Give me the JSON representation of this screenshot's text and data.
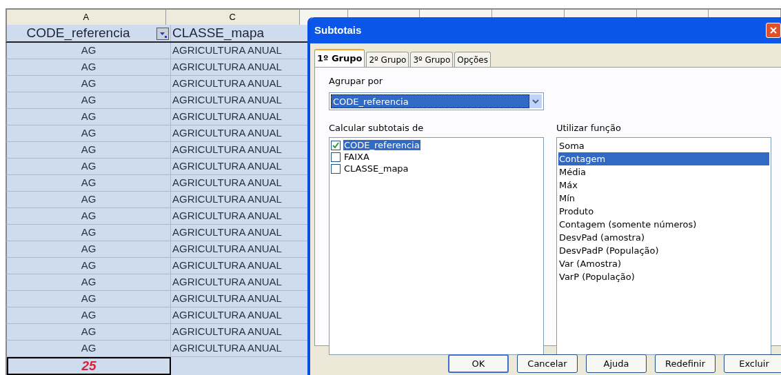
{
  "sheet": {
    "columns": [
      {
        "label": "A",
        "selected": true
      },
      {
        "label": "C",
        "selected": true
      }
    ],
    "header_row": {
      "col_a": "CODE_referencia",
      "col_c": "CLASSE_mapa",
      "filter": true
    },
    "rows": [
      [
        "AG",
        "AGRICULTURA ANUAL"
      ],
      [
        "AG",
        "AGRICULTURA ANUAL"
      ],
      [
        "AG",
        "AGRICULTURA ANUAL"
      ],
      [
        "AG",
        "AGRICULTURA ANUAL"
      ],
      [
        "AG",
        "AGRICULTURA ANUAL"
      ],
      [
        "AG",
        "AGRICULTURA ANUAL"
      ],
      [
        "AG",
        "AGRICULTURA ANUAL"
      ],
      [
        "AG",
        "AGRICULTURA ANUAL"
      ],
      [
        "AG",
        "AGRICULTURA ANUAL"
      ],
      [
        "AG",
        "AGRICULTURA ANUAL"
      ],
      [
        "AG",
        "AGRICULTURA ANUAL"
      ],
      [
        "AG",
        "AGRICULTURA ANUAL"
      ],
      [
        "AG",
        "AGRICULTURA ANUAL"
      ],
      [
        "AG",
        "AGRICULTURA ANUAL"
      ],
      [
        "AG",
        "AGRICULTURA ANUAL"
      ],
      [
        "AG",
        "AGRICULTURA ANUAL"
      ],
      [
        "AG",
        "AGRICULTURA ANUAL"
      ],
      [
        "AG",
        "AGRICULTURA ANUAL"
      ],
      [
        "AG",
        "AGRICULTURA ANUAL"
      ]
    ],
    "total": "25"
  },
  "dialog": {
    "title": "Subtotais",
    "tabs": [
      {
        "label": "1º Grupo",
        "selected": true
      },
      {
        "label": "2º Grupo",
        "selected": false
      },
      {
        "label": "3º Grupo",
        "selected": false
      },
      {
        "label": "Opções",
        "selected": false
      }
    ],
    "group_by": {
      "label": "Agrupar por",
      "value": "CODE_referencia"
    },
    "fields": {
      "label": "Calcular subtotais de",
      "items": [
        {
          "label": "CODE_referencia",
          "checked": true,
          "selected": true
        },
        {
          "label": "FAIXA",
          "checked": false,
          "selected": false
        },
        {
          "label": "CLASSE_mapa",
          "checked": false,
          "selected": false
        }
      ]
    },
    "functions": {
      "label": "Utilizar função",
      "items": [
        {
          "label": "Soma",
          "selected": false
        },
        {
          "label": "Contagem",
          "selected": true
        },
        {
          "label": "Média",
          "selected": false
        },
        {
          "label": "Máx",
          "selected": false
        },
        {
          "label": "Mín",
          "selected": false
        },
        {
          "label": "Produto",
          "selected": false
        },
        {
          "label": "Contagem (somente números)",
          "selected": false
        },
        {
          "label": "DesvPad (amostra)",
          "selected": false
        },
        {
          "label": "DesvPadP (População)",
          "selected": false
        },
        {
          "label": "Var (Amostra)",
          "selected": false
        },
        {
          "label": "VarP (População)",
          "selected": false
        }
      ]
    },
    "buttons": [
      {
        "label": "OK",
        "default": true
      },
      {
        "label": "Cancelar",
        "default": false
      },
      {
        "label": "Ajuda",
        "default": false
      },
      {
        "label": "Redefinir",
        "default": false
      },
      {
        "label": "Excluir",
        "default": false
      }
    ]
  }
}
